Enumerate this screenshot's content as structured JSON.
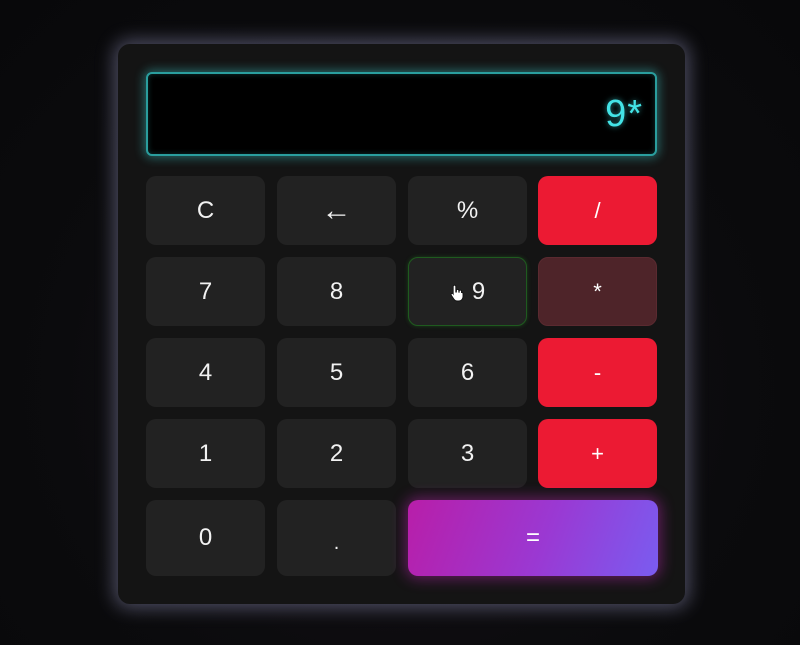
{
  "display": {
    "value": "9*"
  },
  "buttons": {
    "clear": "C",
    "backspace": "←",
    "percent": "%",
    "divide": "/",
    "seven": "7",
    "eight": "8",
    "nine": "9",
    "multiply": "*",
    "four": "4",
    "five": "5",
    "six": "6",
    "subtract": "-",
    "one": "1",
    "two": "2",
    "three": "3",
    "add": "+",
    "zero": "0",
    "decimal": ".",
    "equals": "="
  },
  "colors": {
    "operator": "#ec1a33",
    "display_text": "#43e3e6",
    "equals_gradient_start": "#b81ea9",
    "equals_gradient_end": "#7a5cf0"
  }
}
